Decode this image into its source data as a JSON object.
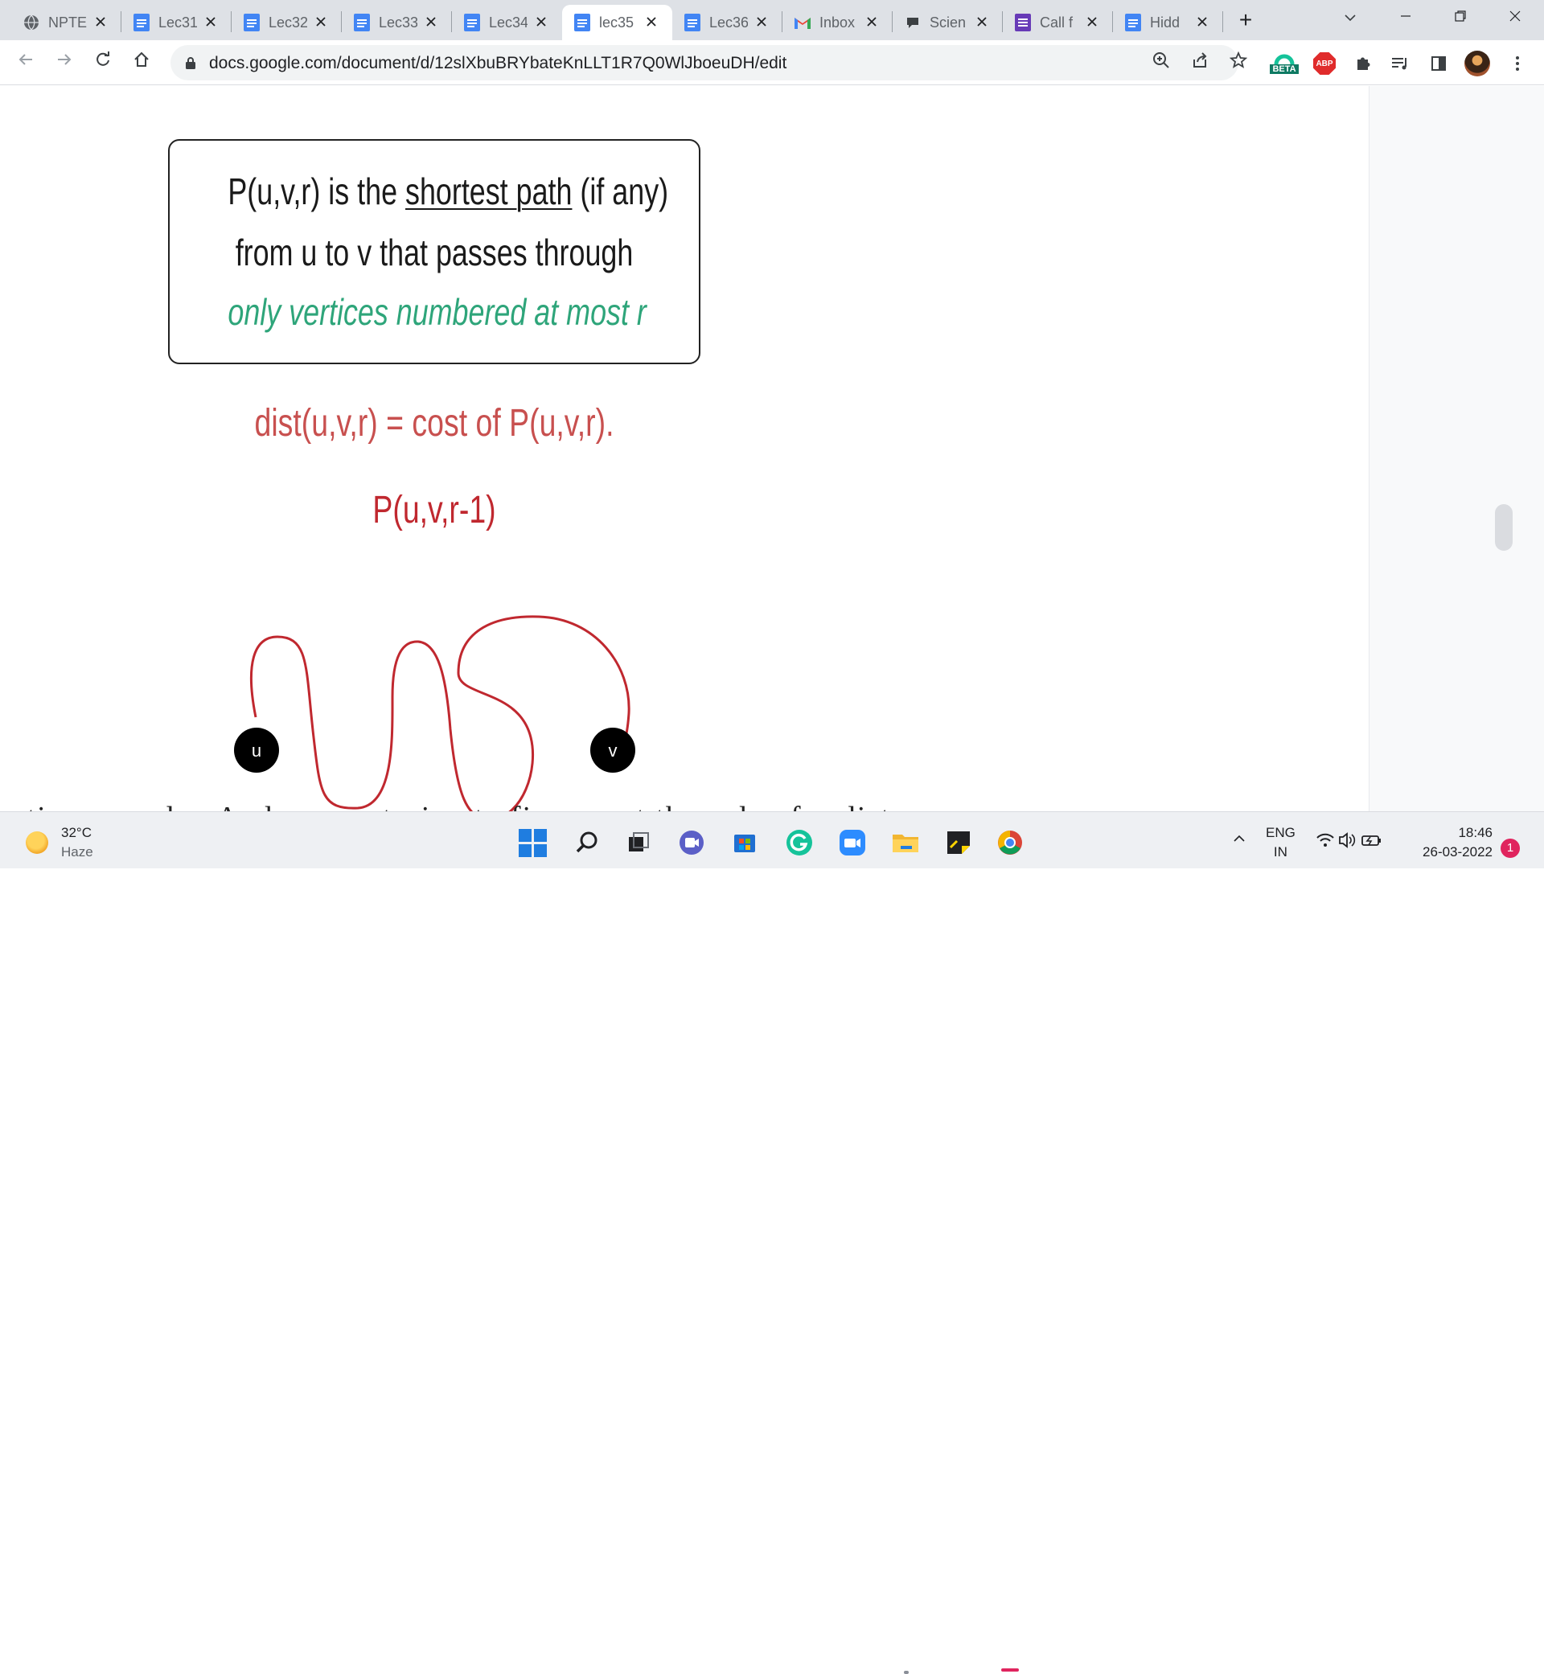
{
  "browser": {
    "tabs": [
      {
        "label": "NPTE",
        "favicon": "globe-icon",
        "active": false
      },
      {
        "label": "Lec31",
        "favicon": "docs-icon",
        "active": false
      },
      {
        "label": "Lec32",
        "favicon": "docs-icon",
        "active": false
      },
      {
        "label": "Lec33",
        "favicon": "docs-icon",
        "active": false
      },
      {
        "label": "Lec34",
        "favicon": "docs-icon",
        "active": false
      },
      {
        "label": "lec35",
        "favicon": "docs-icon",
        "active": true
      },
      {
        "label": "Lec36",
        "favicon": "docs-icon",
        "active": false
      },
      {
        "label": "Inbox",
        "favicon": "gmail-icon",
        "active": false
      },
      {
        "label": "Scien",
        "favicon": "chat-icon",
        "active": false
      },
      {
        "label": "Call f",
        "favicon": "forms-icon",
        "active": false
      },
      {
        "label": "Hidd",
        "favicon": "docs-icon",
        "active": false
      }
    ],
    "new_tab": "+",
    "url": "docs.google.com/document/d/12slXbuBRYbateKnLLT1R7Q0WlJboeuDH/edit",
    "grammarly_badge": "BETA",
    "abp_badge": "ABP"
  },
  "document": {
    "definition": {
      "line1_prefix": "P(u,v,r) is the ",
      "line1_underlined": "shortest path",
      "line1_suffix": " (if any)",
      "line2": "from u to v that passes through",
      "line3": "only vertices numbered at most r"
    },
    "formula": "dist(u,v,r) = cost of P(u,v,r).",
    "path_label": "P(u,v,r-1)",
    "node_u": "u",
    "node_v": "v",
    "cut_text": "ertices u and v. And we are trying to figure out the value for distance u v r"
  },
  "taskbar": {
    "temperature": "32°C",
    "condition": "Haze",
    "language": "ENG",
    "region": "IN",
    "time": "18:46",
    "date": "26-03-2022",
    "notifications": "1"
  },
  "colors": {
    "accent_green": "#2ea57a",
    "accent_red": "#c8504f",
    "path_red": "#c0282f"
  }
}
